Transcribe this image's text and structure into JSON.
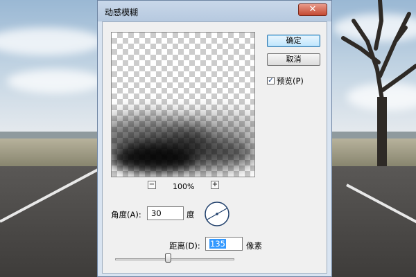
{
  "dialog": {
    "title": "动感模糊",
    "close_icon": "close-icon",
    "buttons": {
      "ok": "确定",
      "cancel": "取消"
    },
    "preview_checkbox": {
      "label": "预览(P)",
      "checked": true
    },
    "zoom": {
      "minus": "−",
      "plus": "+",
      "level": "100%"
    },
    "angle": {
      "label": "角度(A):",
      "value": "30",
      "unit": "度"
    },
    "distance": {
      "label": "距离(D):",
      "value": "135",
      "unit": "像素"
    },
    "distance_slider_fraction": 0.44
  }
}
